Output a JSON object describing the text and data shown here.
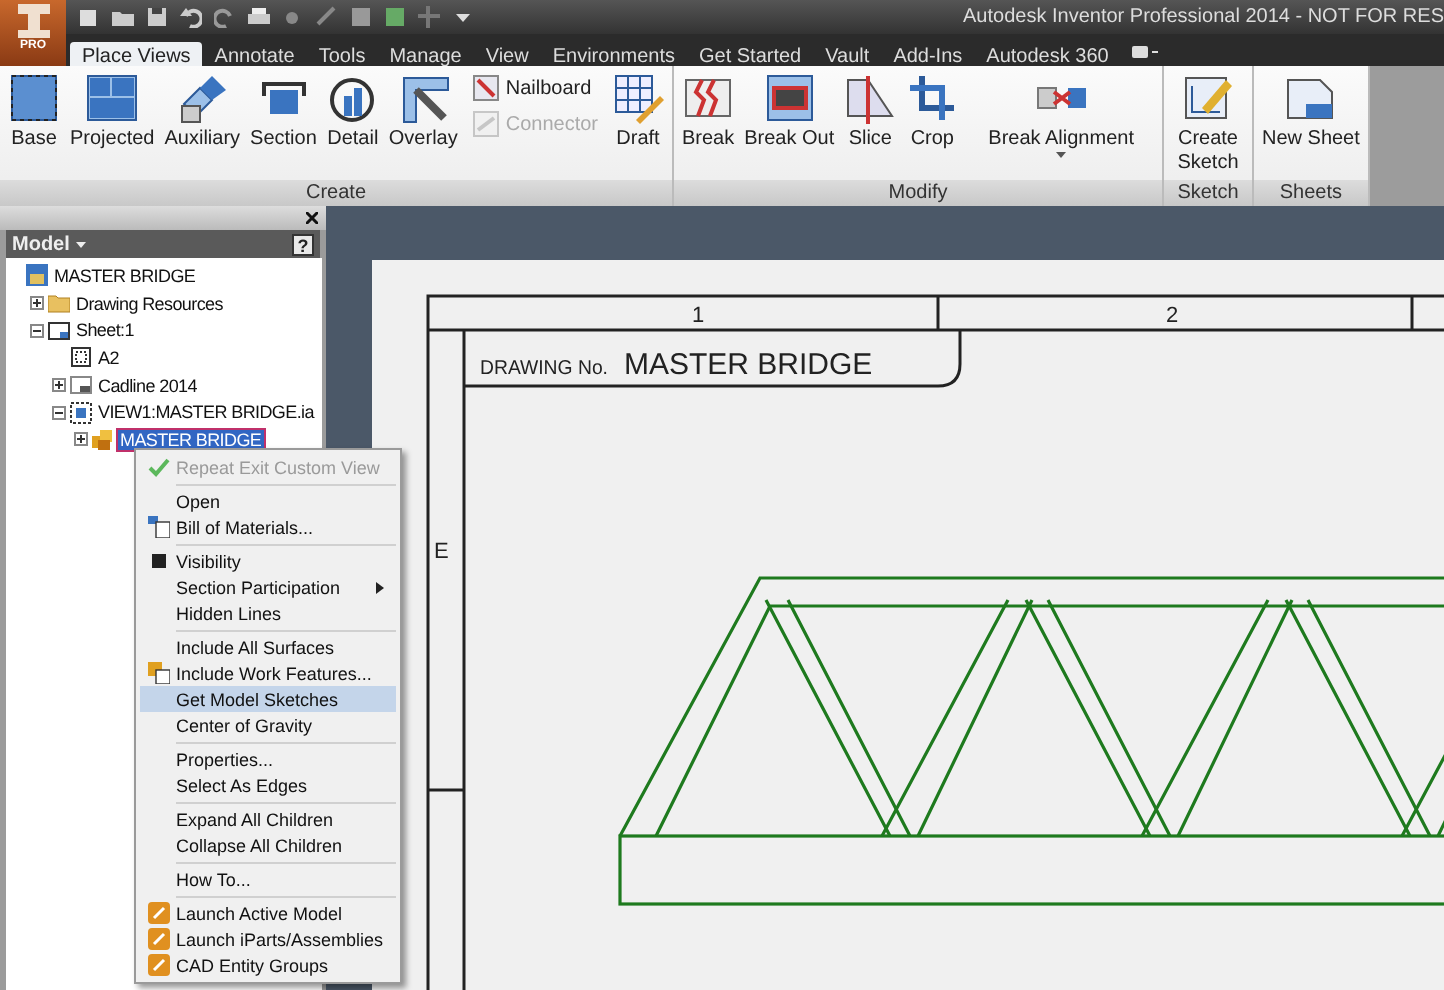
{
  "title_bar": {
    "app_button": {
      "label": "PRO"
    },
    "title": "Autodesk Inventor Professional 2014 - NOT FOR RES"
  },
  "tabs": [
    {
      "label": "Place Views",
      "selected": true
    },
    {
      "label": "Annotate",
      "selected": false
    },
    {
      "label": "Tools",
      "selected": false
    },
    {
      "label": "Manage",
      "selected": false
    },
    {
      "label": "View",
      "selected": false
    },
    {
      "label": "Environments",
      "selected": false
    },
    {
      "label": "Get Started",
      "selected": false
    },
    {
      "label": "Vault",
      "selected": false
    },
    {
      "label": "Add-Ins",
      "selected": false
    },
    {
      "label": "Autodesk 360",
      "selected": false
    }
  ],
  "ribbon": {
    "panels": [
      {
        "title": "Create",
        "buttons": [
          {
            "kind": "large",
            "label": "Base",
            "disabled": false
          },
          {
            "kind": "large",
            "label": "Projected",
            "disabled": false
          },
          {
            "kind": "large",
            "label": "Auxiliary",
            "disabled": false
          },
          {
            "kind": "large",
            "label": "Section",
            "disabled": false
          },
          {
            "kind": "large",
            "label": "Detail",
            "disabled": false
          },
          {
            "kind": "large",
            "label": "Overlay",
            "disabled": false
          },
          {
            "kind": "small",
            "label": "Nailboard",
            "disabled": false
          },
          {
            "kind": "small",
            "label": "Connector",
            "disabled": true
          },
          {
            "kind": "large",
            "label": "Draft",
            "disabled": false
          }
        ]
      },
      {
        "title": "Modify",
        "buttons": [
          {
            "kind": "large",
            "label": "Break",
            "disabled": false
          },
          {
            "kind": "large",
            "label": "Break Out",
            "disabled": false
          },
          {
            "kind": "large",
            "label": "Slice",
            "disabled": false
          },
          {
            "kind": "large",
            "label": "Crop",
            "disabled": false
          },
          {
            "kind": "dropdown",
            "label": "Break Alignment",
            "disabled": false
          }
        ]
      },
      {
        "title": "Sketch",
        "buttons": [
          {
            "kind": "large",
            "label": "Create Sketch",
            "disabled": false
          }
        ]
      },
      {
        "title": "Sheets",
        "buttons": [
          {
            "kind": "large",
            "label": "New Sheet",
            "disabled": false
          }
        ]
      }
    ]
  },
  "browser": {
    "title": "Model",
    "help": "?",
    "tree": [
      {
        "label": "MASTER BRIDGE",
        "selected": false,
        "children": [
          {
            "label": "Drawing Resources",
            "expanded": false,
            "selected": false
          },
          {
            "label": "Sheet:1",
            "expanded": true,
            "selected": false,
            "children": [
              {
                "label": "A2",
                "selected": false
              },
              {
                "label": "Cadline 2014",
                "expanded": false,
                "selected": false
              },
              {
                "label": "VIEW1:MASTER BRIDGE.ia",
                "expanded": true,
                "selected": false,
                "children": [
                  {
                    "label": "MASTER BRIDGE",
                    "expanded": false,
                    "selected": true
                  }
                ]
              }
            ]
          }
        ]
      }
    ]
  },
  "sheet": {
    "columns": [
      "1",
      "2"
    ],
    "rows": [
      "E"
    ],
    "title_block": {
      "label": "DRAWING No.",
      "value": "MASTER BRIDGE"
    }
  },
  "context_menu": [
    {
      "kind": "item",
      "label": "Repeat Exit Custom View",
      "disabled": true,
      "checked": false,
      "selected": false,
      "submenu": false
    },
    {
      "kind": "separator"
    },
    {
      "kind": "item",
      "label": "Open",
      "disabled": false,
      "checked": false,
      "selected": false,
      "submenu": false
    },
    {
      "kind": "item",
      "label": "Bill of Materials...",
      "disabled": false,
      "checked": false,
      "selected": false,
      "submenu": false
    },
    {
      "kind": "separator"
    },
    {
      "kind": "item",
      "label": "Visibility",
      "disabled": false,
      "checked": true,
      "selected": false,
      "submenu": false
    },
    {
      "kind": "item",
      "label": "Section Participation",
      "disabled": false,
      "checked": false,
      "selected": false,
      "submenu": true
    },
    {
      "kind": "item",
      "label": "Hidden Lines",
      "disabled": false,
      "checked": false,
      "selected": false,
      "submenu": false
    },
    {
      "kind": "separator"
    },
    {
      "kind": "item",
      "label": "Include All Surfaces",
      "disabled": false,
      "checked": false,
      "selected": false,
      "submenu": false
    },
    {
      "kind": "item",
      "label": "Include Work Features...",
      "disabled": false,
      "checked": false,
      "selected": false,
      "submenu": false
    },
    {
      "kind": "item",
      "label": "Get Model Sketches",
      "disabled": false,
      "checked": false,
      "selected": true,
      "submenu": false
    },
    {
      "kind": "item",
      "label": "Center of Gravity",
      "disabled": false,
      "checked": false,
      "selected": false,
      "submenu": false
    },
    {
      "kind": "separator"
    },
    {
      "kind": "item",
      "label": "Properties...",
      "disabled": false,
      "checked": false,
      "selected": false,
      "submenu": false
    },
    {
      "kind": "item",
      "label": "Select As Edges",
      "disabled": false,
      "checked": false,
      "selected": false,
      "submenu": false
    },
    {
      "kind": "separator"
    },
    {
      "kind": "item",
      "label": "Expand All Children",
      "disabled": false,
      "checked": false,
      "selected": false,
      "submenu": false
    },
    {
      "kind": "item",
      "label": "Collapse All Children",
      "disabled": false,
      "checked": false,
      "selected": false,
      "submenu": false
    },
    {
      "kind": "separator"
    },
    {
      "kind": "item",
      "label": "How To...",
      "disabled": false,
      "checked": false,
      "selected": false,
      "submenu": false
    },
    {
      "kind": "separator"
    },
    {
      "kind": "item",
      "label": "Launch Active Model",
      "disabled": false,
      "checked": false,
      "selected": false,
      "submenu": false
    },
    {
      "kind": "item",
      "label": "Launch iParts/Assemblies",
      "disabled": false,
      "checked": false,
      "selected": false,
      "submenu": false
    },
    {
      "kind": "item",
      "label": "CAD Entity Groups",
      "disabled": false,
      "checked": false,
      "selected": false,
      "submenu": false
    }
  ]
}
